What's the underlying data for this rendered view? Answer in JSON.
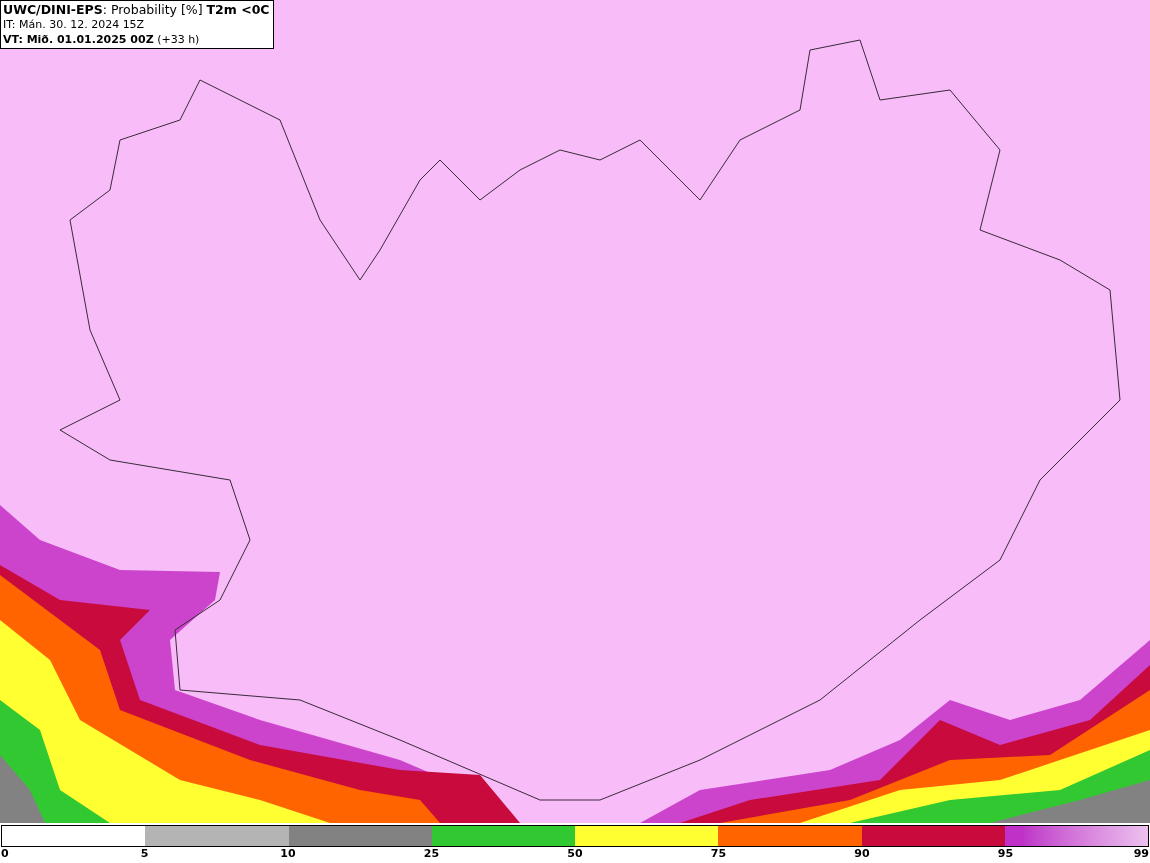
{
  "header": {
    "lines": [
      "**UWC/DINI-EPS**: Probability [%] **T2m <0C**",
      "IT: Mán. 30. 12. 2024 15Z",
      "**VT: Mið. 01.01.2025 00Z** (+33 h)"
    ]
  },
  "legend": {
    "labels": [
      "0",
      "5",
      "10",
      "25",
      "50",
      "75",
      "90",
      "95",
      "99"
    ],
    "segments": [
      {
        "color": "#ffffff"
      },
      {
        "color": "#b4b4b4"
      },
      {
        "color": "#828282"
      },
      {
        "color": "#32c832"
      },
      {
        "color": "#ffff32"
      },
      {
        "color": "#ff6400"
      },
      {
        "color": "#c80a3c"
      },
      {
        "color": "#be32c8",
        "kind": "fade"
      }
    ]
  }
}
